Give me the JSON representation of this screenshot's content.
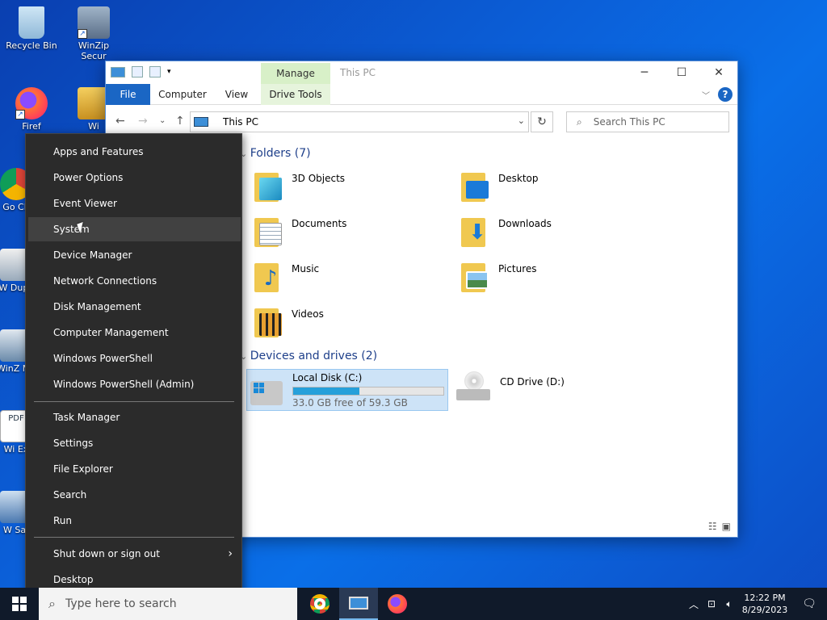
{
  "desktop": {
    "icons": [
      {
        "label": "Recycle Bin"
      },
      {
        "label": "WinZip Secur"
      },
      {
        "label": "Firef"
      },
      {
        "label": "Wi"
      },
      {
        "label": "Go Ch"
      },
      {
        "label": "W Dupli"
      },
      {
        "label": "WinZ Ma"
      },
      {
        "label": "Wi Ex"
      },
      {
        "label": "W Saf"
      }
    ]
  },
  "explorer": {
    "title": "This PC",
    "manage_tab": "Manage",
    "ribbon_tabs": {
      "file": "File",
      "computer": "Computer",
      "view": "View",
      "drive_tools": "Drive Tools"
    },
    "help": "?",
    "address": "This PC",
    "search_placeholder": "Search This PC",
    "folders_header": "Folders (7)",
    "folders": [
      {
        "name": "3D Objects"
      },
      {
        "name": "Desktop"
      },
      {
        "name": "Documents"
      },
      {
        "name": "Downloads"
      },
      {
        "name": "Music"
      },
      {
        "name": "Pictures"
      },
      {
        "name": "Videos"
      }
    ],
    "devices_header": "Devices and drives (2)",
    "drives": [
      {
        "name": "Local Disk (C:)",
        "free_text": "33.0 GB free of 59.3 GB",
        "used_fraction": 0.44
      },
      {
        "name": "CD Drive (D:)"
      }
    ]
  },
  "context_menu": {
    "items": [
      "Apps and Features",
      "Power Options",
      "Event Viewer",
      "System",
      "Device Manager",
      "Network Connections",
      "Disk Management",
      "Computer Management",
      "Windows PowerShell",
      "Windows PowerShell (Admin)",
      "Task Manager",
      "Settings",
      "File Explorer",
      "Search",
      "Run",
      "Shut down or sign out",
      "Desktop"
    ],
    "hovered": "System"
  },
  "taskbar": {
    "search_placeholder": "Type here to search",
    "time": "12:22 PM",
    "date": "8/29/2023"
  }
}
